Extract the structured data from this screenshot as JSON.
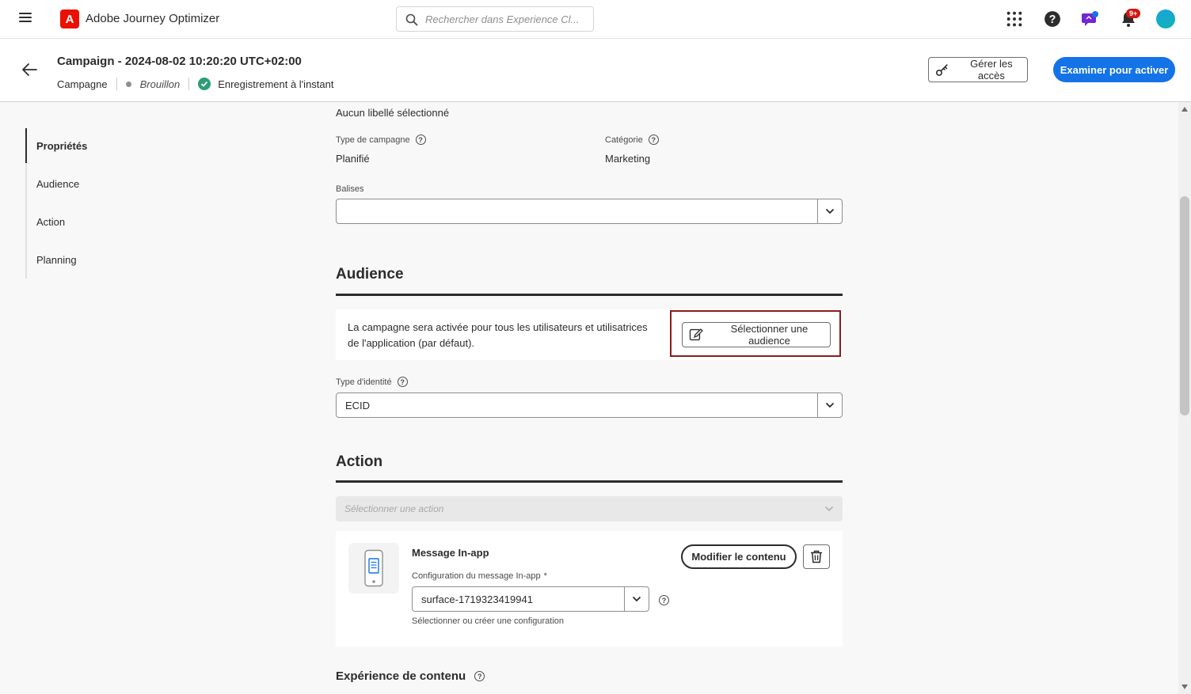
{
  "topbar": {
    "app_title": "Adobe Journey Optimizer",
    "search_placeholder": "Rechercher dans Experience Cl...",
    "notifications_badge": "9+"
  },
  "header": {
    "campaign_title": "Campaign - 2024-08-02 10:20:20 UTC+02:00",
    "type_label": "Campagne",
    "status_label": "Brouillon",
    "save_status": "Enregistrement à l'instant",
    "manage_access_label": "Gérer les accès",
    "review_activate_label": "Examiner pour activer"
  },
  "leftnav": {
    "items": [
      {
        "label": "Propriétés"
      },
      {
        "label": "Audience"
      },
      {
        "label": "Action"
      },
      {
        "label": "Planning"
      }
    ]
  },
  "properties": {
    "labels_value": "Aucun libellé sélectionné",
    "campaign_type_label": "Type de campagne",
    "campaign_type_value": "Planifié",
    "category_label": "Catégorie",
    "category_value": "Marketing",
    "tags_label": "Balises",
    "tags_value": ""
  },
  "audience": {
    "title": "Audience",
    "description": "La campagne sera activée pour tous les utilisateurs et utilisatrices de l'application (par défaut).",
    "select_audience_label": "Sélectionner une audience",
    "identity_type_label": "Type d'identité",
    "identity_type_value": "ECID"
  },
  "action": {
    "title": "Action",
    "select_action_placeholder": "Sélectionner une action",
    "message_title": "Message In-app",
    "config_label": "Configuration du message In-app",
    "config_required_mark": "*",
    "config_value": "surface-1719323419941",
    "config_help": "Sélectionner ou créer une configuration",
    "edit_content_label": "Modifier le contenu"
  },
  "content_experience": {
    "title": "Expérience de contenu"
  },
  "colors": {
    "accent": "#1473e6",
    "brand": "#eb1000",
    "success": "#2d9d78",
    "highlight": "#8a1c1c"
  }
}
